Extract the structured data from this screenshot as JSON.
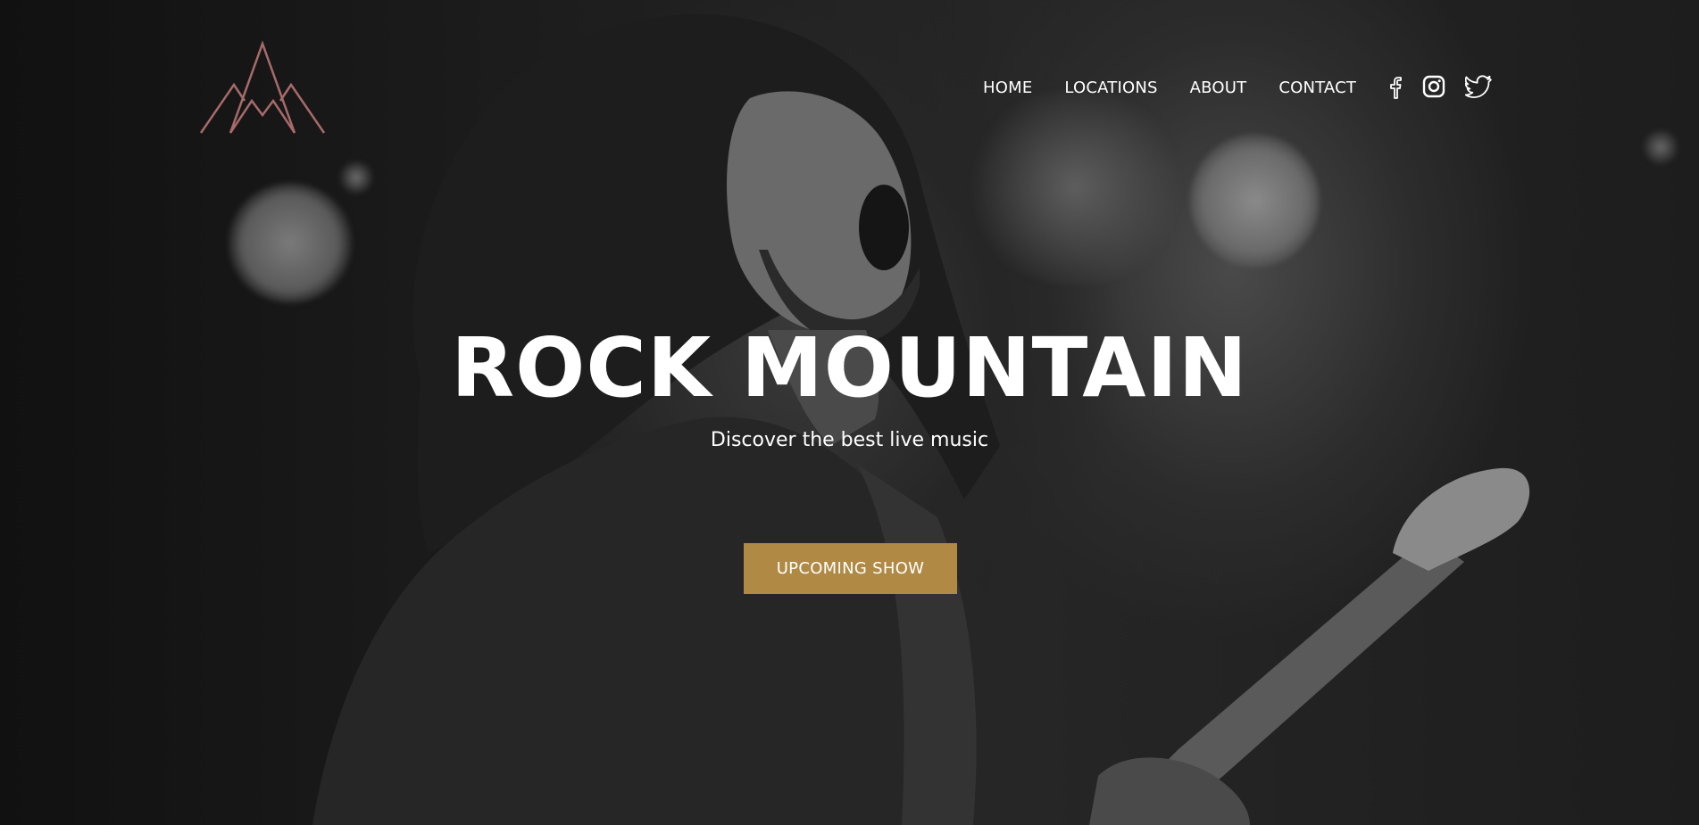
{
  "brand": {
    "logo_icon": "mountain-logo-icon",
    "logo_color": "#a86a6a"
  },
  "nav": {
    "items": [
      {
        "label": "HOME"
      },
      {
        "label": "LOCATIONS"
      },
      {
        "label": "ABOUT"
      },
      {
        "label": "CONTACT"
      }
    ],
    "social": [
      {
        "icon": "facebook-icon"
      },
      {
        "icon": "instagram-icon"
      },
      {
        "icon": "twitter-icon"
      }
    ]
  },
  "hero": {
    "title": "ROCK MOUNTAIN",
    "subtitle": "Discover the best live music",
    "cta_label": "UPCOMING SHOW",
    "accent_color": "#b08a45",
    "background_image": "black-and-white photo of long-haired singer with guitar"
  }
}
